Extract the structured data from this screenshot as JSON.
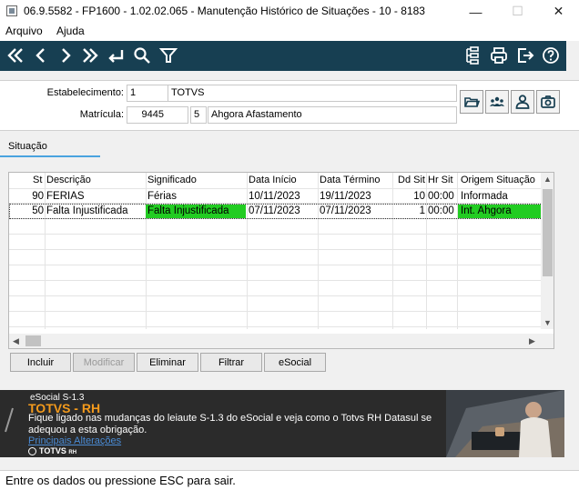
{
  "window": {
    "title": "06.9.5582 - FP1600 - 1.02.02.065 - Manutenção Histórico de Situações - 10 - 8183",
    "minimize": "—",
    "maximize": "☐",
    "close": "✕"
  },
  "menu": {
    "arquivo": "Arquivo",
    "ajuda": "Ajuda"
  },
  "toolbar": {
    "icons": [
      "first-icon",
      "prev-icon",
      "next-icon",
      "last-icon",
      "return-icon",
      "search-icon",
      "filter-icon",
      "tree-icon",
      "print-icon",
      "exit-icon",
      "help-icon"
    ],
    "color": "#173f52"
  },
  "header": {
    "estabelecimento_label": "Estabelecimento:",
    "estabelecimento_code": "1",
    "estabelecimento_name": "TOTVS",
    "matricula_label": "Matrícula:",
    "matricula_value": "9445",
    "matricula_digit": "5",
    "matricula_name": "Ahgora Afastamento"
  },
  "tabs": {
    "situacao": "Situação"
  },
  "grid": {
    "columns": {
      "st": "St",
      "descricao": "Descrição",
      "significado": "Significado",
      "data_inicio": "Data Início",
      "data_termino": "Data Término",
      "dd_sit": "Dd Sit",
      "hr_sit": "Hr Sit",
      "origem": "Origem Situação"
    },
    "rows": [
      {
        "st": "90",
        "descricao": "FERIAS",
        "significado": "Férias",
        "data_inicio": "10/11/2023",
        "data_termino": "19/11/2023",
        "dd_sit": "10",
        "hr_sit": "00:00",
        "origem": "Informada"
      },
      {
        "st": "50",
        "descricao": "Falta Injustificada",
        "significado": "Falta Injustificada",
        "data_inicio": "07/11/2023",
        "data_termino": "07/11/2023",
        "dd_sit": "1",
        "hr_sit": "00:00",
        "origem": "Int. Ahgora"
      }
    ],
    "highlight_color": "#22cc22"
  },
  "actions": {
    "incluir": "Incluir",
    "modificar": "Modificar",
    "eliminar": "Eliminar",
    "filtrar": "Filtrar",
    "esocial": "eSocial"
  },
  "banner": {
    "kicker": "eSocial  S-1.3",
    "title": "TOTVS - RH",
    "text": "Fique ligado nas mudanças do leiaute S-1.3 do eSocial e veja como o Totvs RH Datasul se adequou a esta obrigação.",
    "link": "Principais Alterações",
    "logo": "TOTVS",
    "logo_sub": "RH",
    "accent": "#f39a1c"
  },
  "status": {
    "text": "Entre os dados ou pressione ESC para sair."
  }
}
